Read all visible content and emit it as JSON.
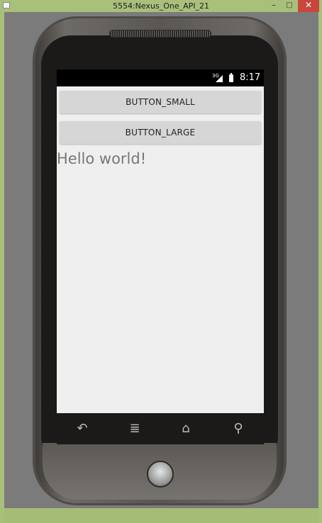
{
  "window": {
    "title": "5554:Nexus_One_API_21",
    "controls": {
      "minimize": "–",
      "maximize": "□",
      "close": "✕"
    }
  },
  "statusbar": {
    "network": "3G",
    "time": "8:17"
  },
  "app": {
    "button_small": "BUTTON_SMALL",
    "button_large": "BUTTON_LARGE",
    "hello_text": "Hello world!"
  },
  "navbar": {
    "back_icon": "↶",
    "menu_icon": "≣",
    "home_icon": "⌂",
    "search_icon": "⚲"
  }
}
